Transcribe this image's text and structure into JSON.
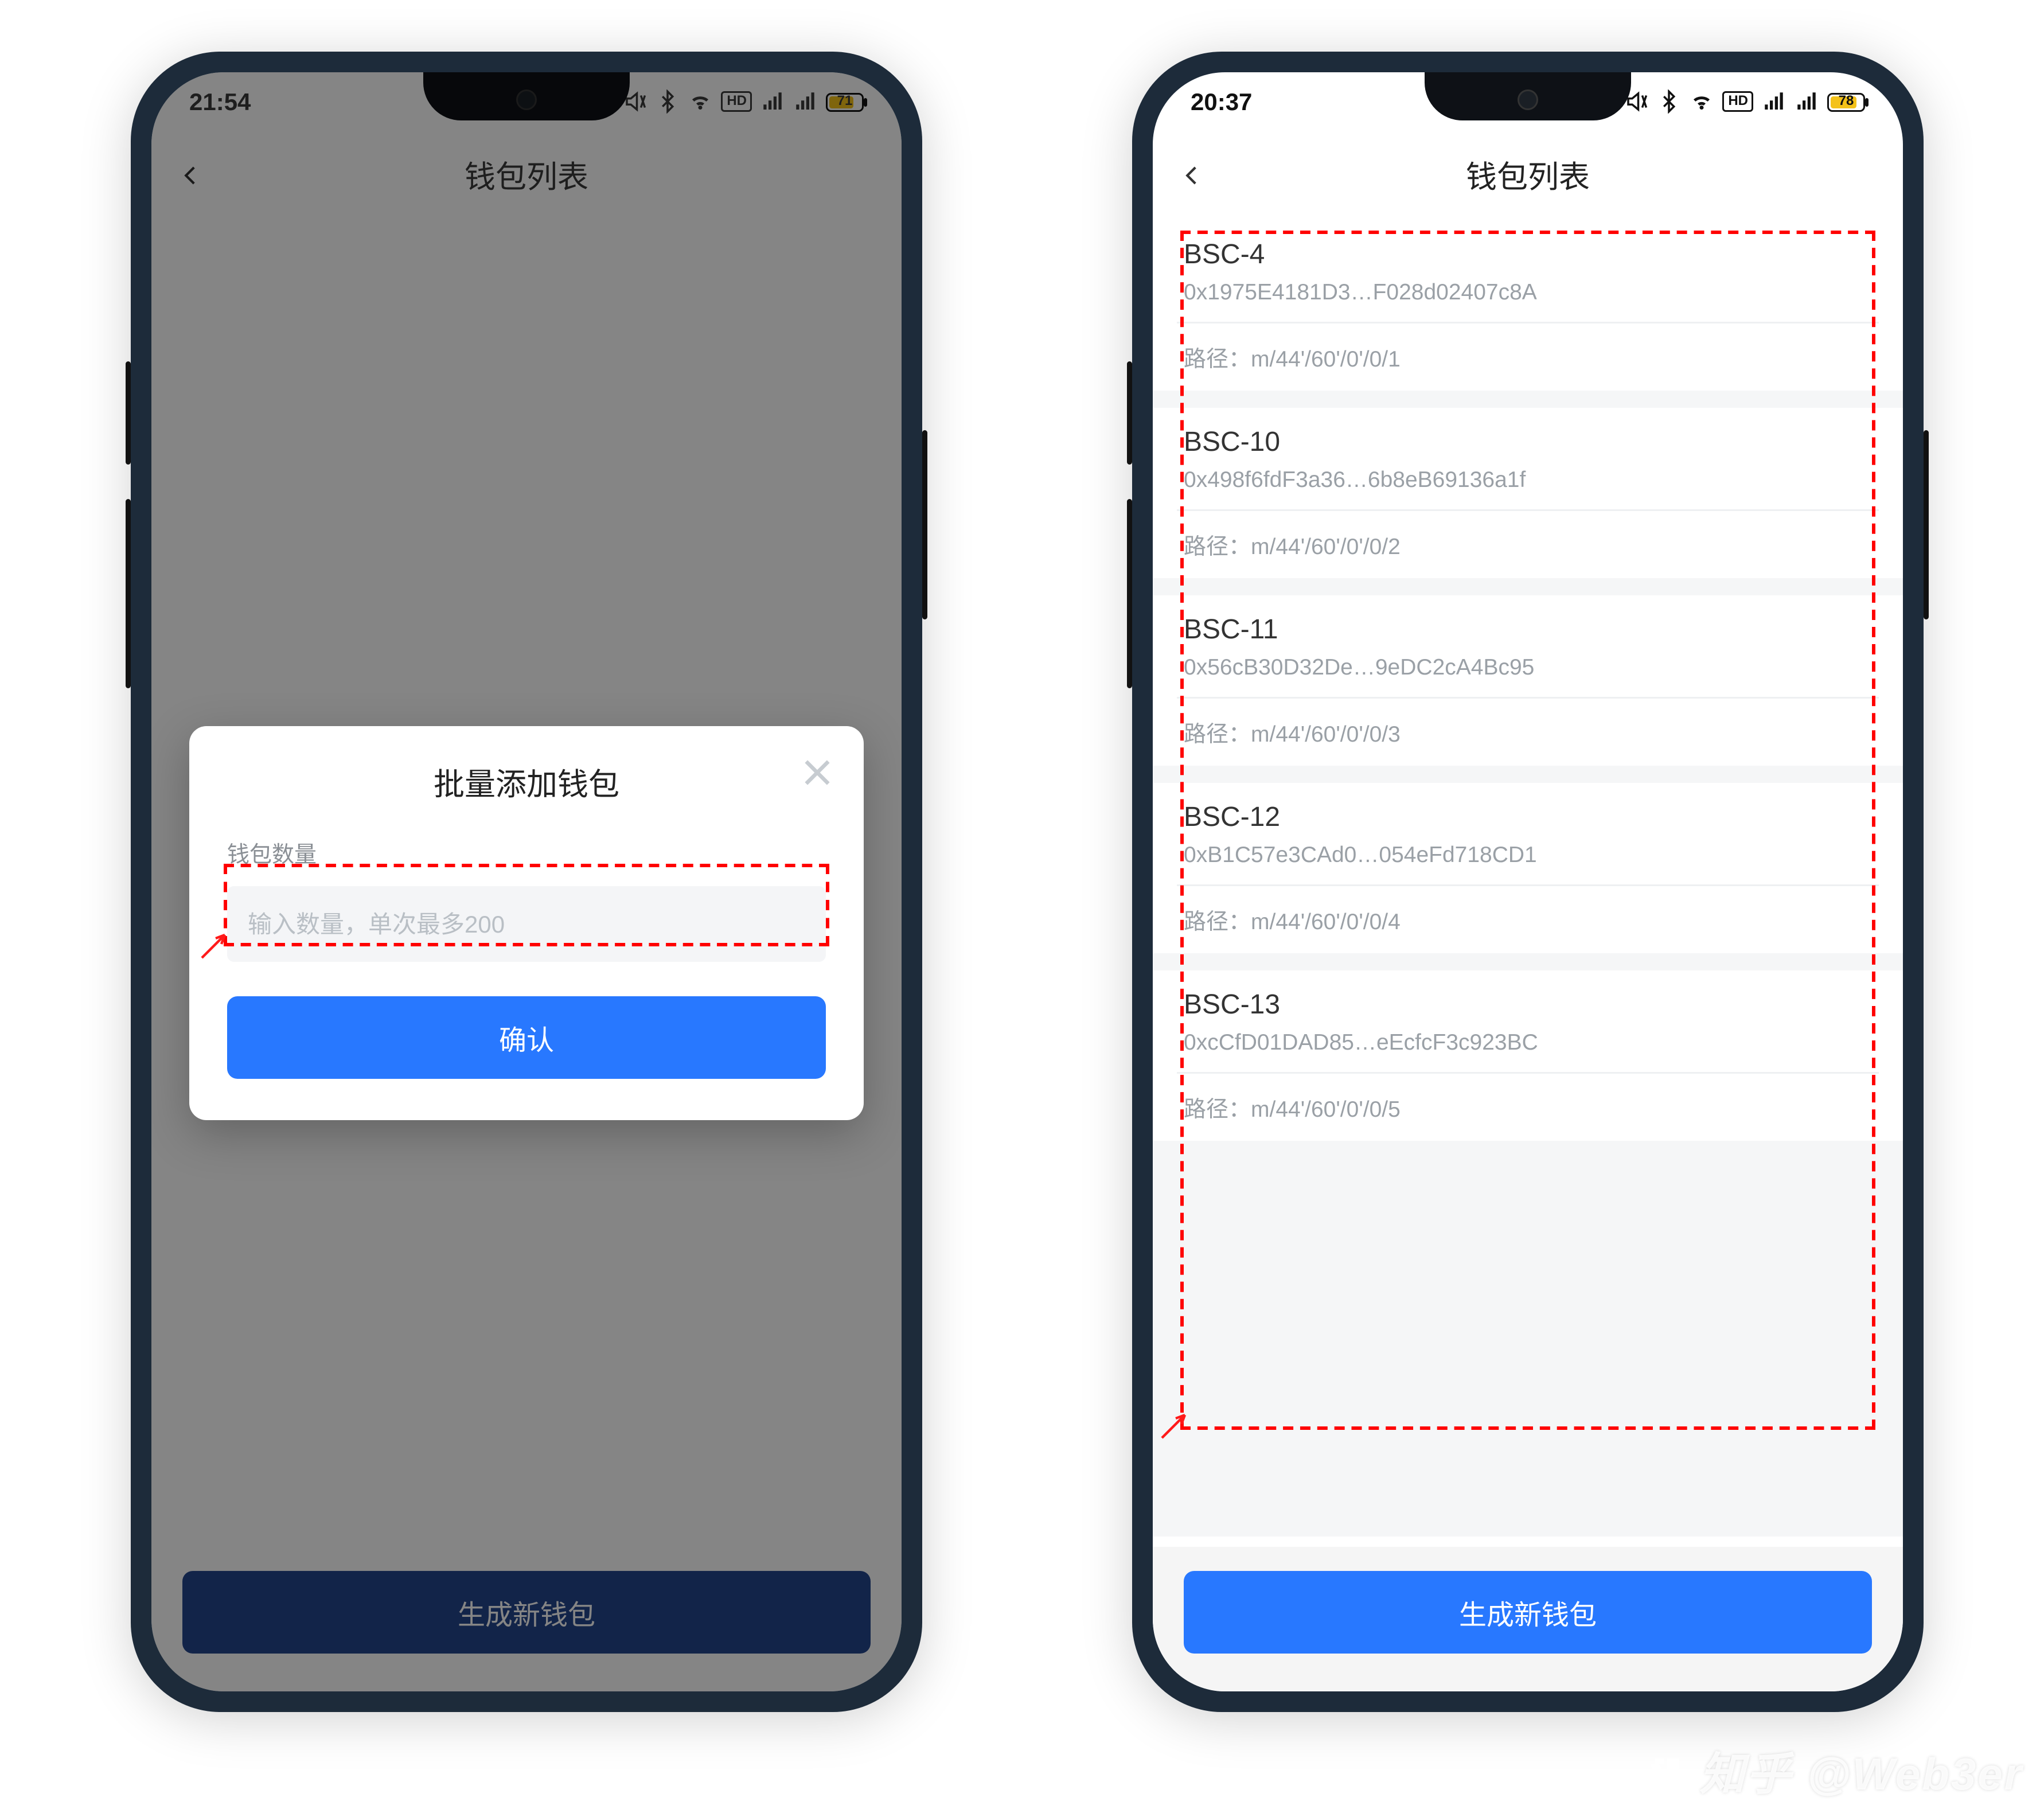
{
  "colors": {
    "primary": "#2878ff",
    "primary_dim": "#24468c",
    "battery_yellow": "#f4c21a"
  },
  "left": {
    "status": {
      "time": "21:54",
      "battery_text": "71",
      "battery_pct": 71
    },
    "nav_title": "钱包列表",
    "bottom_button": "生成新钱包",
    "modal": {
      "title": "批量添加钱包",
      "label": "钱包数量",
      "placeholder": "输入数量，单次最多200",
      "confirm": "确认"
    }
  },
  "right": {
    "status": {
      "time": "20:37",
      "battery_text": "78",
      "battery_pct": 78
    },
    "nav_title": "钱包列表",
    "bottom_button": "生成新钱包",
    "path_label_prefix": "路径：",
    "wallets": [
      {
        "name": "BSC-4",
        "addr": "0x1975E4181D3…F028d02407c8A",
        "path": "m/44'/60'/0'/0/1"
      },
      {
        "name": "BSC-10",
        "addr": "0x498f6fdF3a36…6b8eB69136a1f",
        "path": "m/44'/60'/0'/0/2"
      },
      {
        "name": "BSC-11",
        "addr": "0x56cB30D32De…9eDC2cA4Bc95",
        "path": "m/44'/60'/0'/0/3"
      },
      {
        "name": "BSC-12",
        "addr": "0xB1C57e3CAd0…054eFd718CD1",
        "path": "m/44'/60'/0'/0/4"
      },
      {
        "name": "BSC-13",
        "addr": "0xcCfD01DAD85…eEcfcF3c923BC",
        "path": "m/44'/60'/0'/0/5"
      }
    ]
  },
  "watermark": "知乎 @Web3er"
}
